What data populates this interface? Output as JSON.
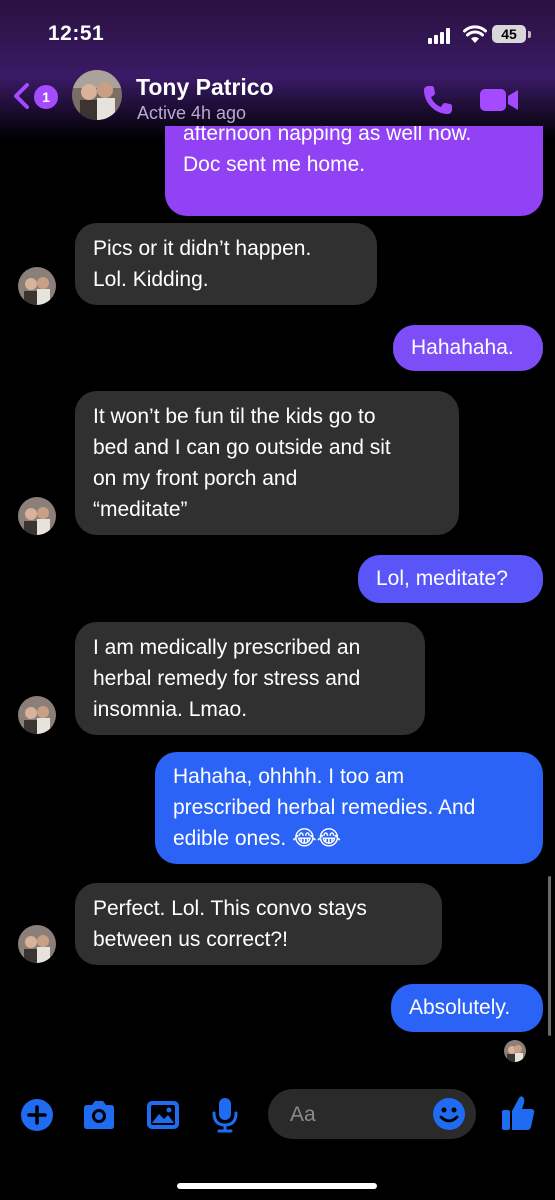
{
  "status_bar": {
    "time": "12:51",
    "battery": "45"
  },
  "header": {
    "back_badge": "1",
    "contact_name": "Tony Patrico",
    "contact_status": "Active 4h ago"
  },
  "messages": [
    {
      "side": "out",
      "text": "afternoon napping as well now.\nDoc sent me home."
    },
    {
      "side": "in",
      "text": "Pics or it didn’t happen.\nLol.  Kidding."
    },
    {
      "side": "out",
      "text": "Hahahaha."
    },
    {
      "side": "in",
      "text": "It won’t be fun til the kids go to\nbed and I can go outside and sit\non my front porch and\n“meditate”"
    },
    {
      "side": "out",
      "text": "Lol, meditate?"
    },
    {
      "side": "in",
      "text": "I am medically prescribed an\nherbal remedy for stress and\ninsomnia.  Lmao."
    },
    {
      "side": "out",
      "text": "Hahaha, ohhhh. I too am\nprescribed herbal remedies. And\nedible ones. 😂😂"
    },
    {
      "side": "in",
      "text": "Perfect.  Lol.  This convo stays\nbetween us correct?!"
    },
    {
      "side": "out",
      "text": "Absolutely."
    }
  ],
  "composer": {
    "placeholder": "Aa"
  },
  "icons": {
    "back": "chevron-left-icon",
    "call": "phone-icon",
    "video": "video-camera-icon",
    "add": "plus-circle-icon",
    "camera": "camera-icon",
    "gallery": "image-icon",
    "mic": "microphone-icon",
    "emoji": "emoji-icon",
    "like": "thumbs-up-icon"
  },
  "colors": {
    "accent_purple": "#a44bff",
    "incoming_bubble": "#303030",
    "outgoing_purple": "#9242f5",
    "outgoing_blue": "#2b63f6",
    "composer_icons": "#1f6cf2"
  }
}
